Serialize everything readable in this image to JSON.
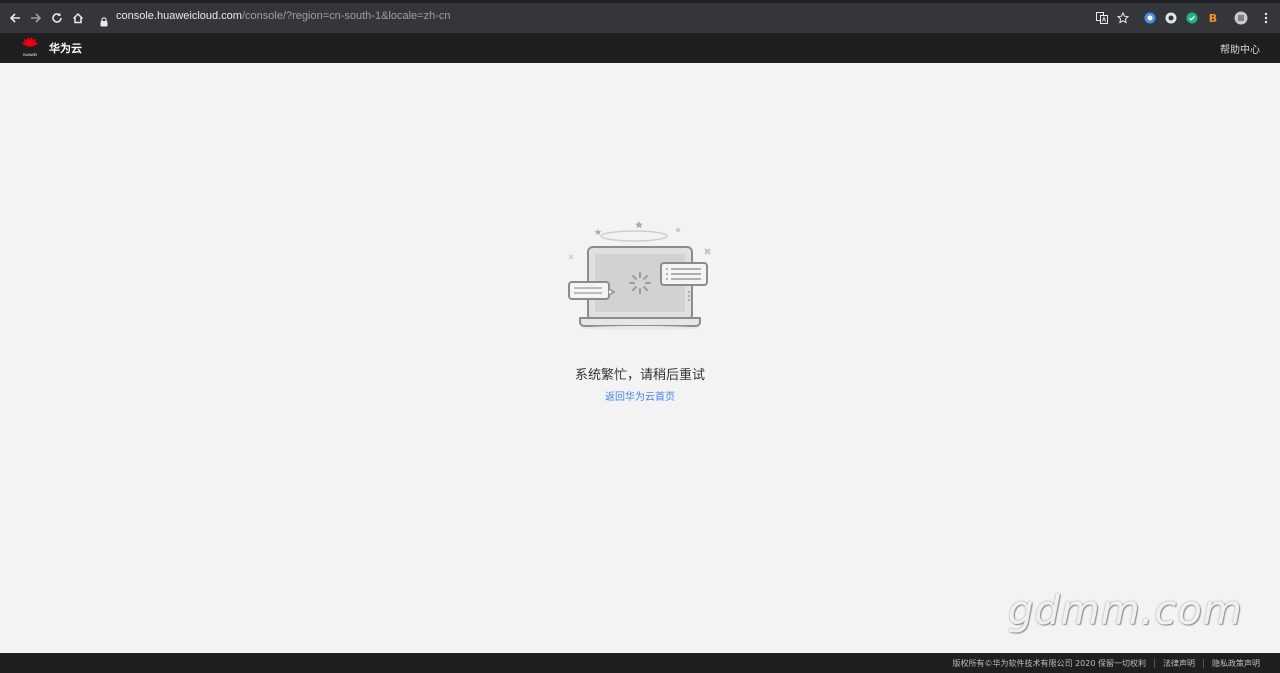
{
  "browser": {
    "url_host": "console.huaweicloud.com",
    "url_path": "/console/?region=cn-south-1&locale=zh-cn",
    "extension_b_label": "B"
  },
  "header": {
    "brand_name": "华为云",
    "logo_text": "HUAWEI",
    "help_label": "帮助中心"
  },
  "main": {
    "error_message": "系统繁忙，请稍后重试",
    "home_link": "返回华为云首页"
  },
  "watermark": "gdmm.com",
  "footer": {
    "copyright": "版权所有©华为软件技术有限公司 2020 保留一切权利",
    "legal": "法律声明",
    "privacy": "隐私政策声明"
  },
  "colors": {
    "brand_red": "#e60012",
    "link_blue": "#3f85e5",
    "header_bg": "#1f1f1f",
    "page_bg": "#f3f3f3"
  },
  "icons": [
    "back-arrow-icon",
    "forward-arrow-icon",
    "reload-icon",
    "home-icon",
    "lock-icon",
    "translate-icon",
    "star-icon",
    "menu-dots-icon",
    "huawei-logo-icon"
  ]
}
